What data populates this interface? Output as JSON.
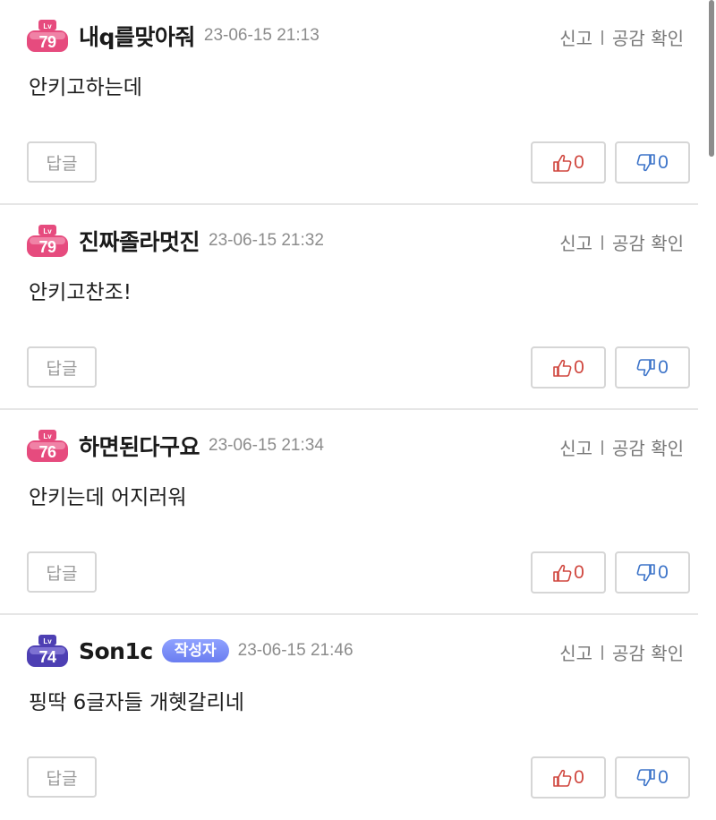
{
  "comments": [
    {
      "level": "79",
      "level_prefix": "Lv",
      "level_color": "#e64b7e",
      "nickname": "내q를맞아줘",
      "is_author": false,
      "author_badge": "",
      "date": "23-06-15 21:13",
      "text": "안키고하는데",
      "report": "신고",
      "likes_check": "공감 확인",
      "reply": "답글",
      "upvotes": "0",
      "downvotes": "0"
    },
    {
      "level": "79",
      "level_prefix": "Lv",
      "level_color": "#e64b7e",
      "nickname": "진짜졸라멋진",
      "is_author": false,
      "author_badge": "",
      "date": "23-06-15 21:32",
      "text": "안키고찬조!",
      "report": "신고",
      "likes_check": "공감 확인",
      "reply": "답글",
      "upvotes": "0",
      "downvotes": "0"
    },
    {
      "level": "76",
      "level_prefix": "Lv",
      "level_color": "#e64b7e",
      "nickname": "하면된다구요",
      "is_author": false,
      "author_badge": "",
      "date": "23-06-15 21:34",
      "text": "안키는데 어지러워",
      "report": "신고",
      "likes_check": "공감 확인",
      "reply": "답글",
      "upvotes": "0",
      "downvotes": "0"
    },
    {
      "level": "74",
      "level_prefix": "Lv",
      "level_color": "#4d3fb3",
      "nickname": "Son1c",
      "is_author": true,
      "author_badge": "작성자",
      "date": "23-06-15 21:46",
      "text": "핑딱 6글자들 개혯갈리네",
      "report": "신고",
      "likes_check": "공감 확인",
      "reply": "답글",
      "upvotes": "0",
      "downvotes": "0"
    }
  ]
}
